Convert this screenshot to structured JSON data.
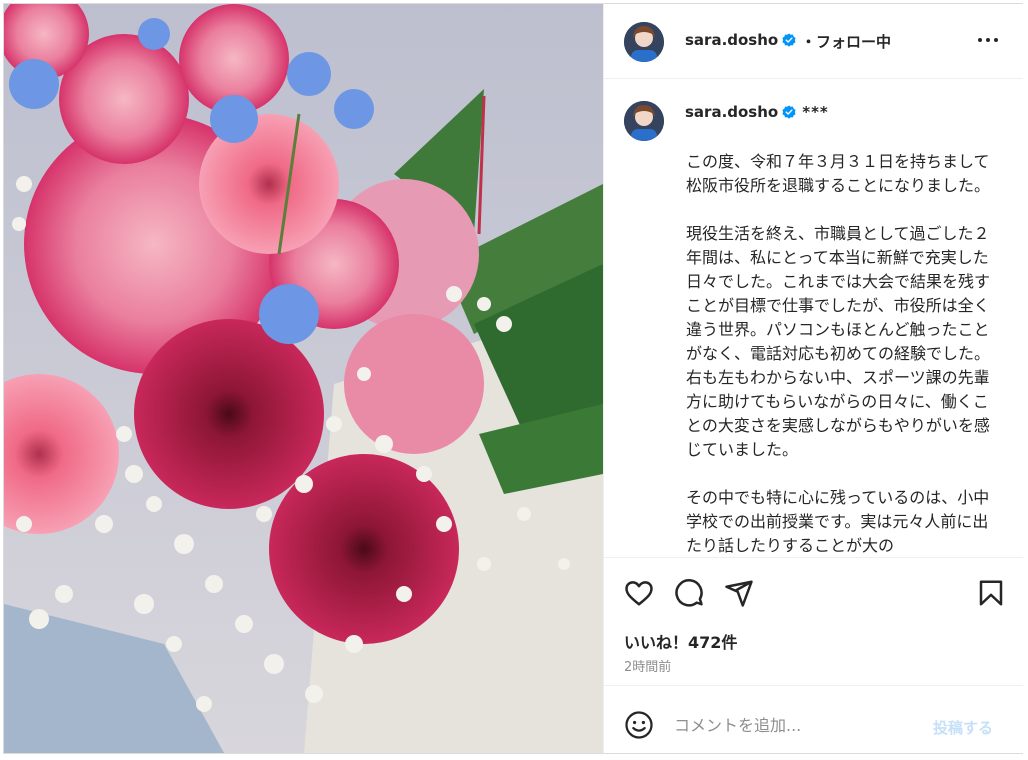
{
  "header": {
    "username": "sara.dosho",
    "separator": "・",
    "follow_label": "フォロー中",
    "more_icon": "more-horizontal-icon"
  },
  "caption": {
    "username": "sara.dosho",
    "stars": "***",
    "text": "この度、令和７年３月３１日を持ちまして松阪市役所を退職することになりました。\n\n現役生活を終え、市職員として過ごした２年間は、私にとって本当に新鮮で充実した日々でした。これまでは大会で結果を残すことが目標で仕事でしたが、市役所は全く違う世界。パソコンもほとんど触ったことがなく、電話対応も初めての経験でした。右も左もわからない中、スポーツ課の先輩方に助けてもらいながらの日々に、働くことの大変さを実感しながらもやりがいを感じていました。\n\nその中でも特に心に残っているのは、小中学校での出前授業です。実は元々人前に出たり話したりすることが大の"
  },
  "actions": {
    "icons": [
      "heart-icon",
      "comment-icon",
      "share-icon",
      "bookmark-icon"
    ],
    "likes": "いいね！472件",
    "time": "2時間前"
  },
  "comment": {
    "placeholder": "コメントを追加...",
    "post_label": "投稿する"
  },
  "colors": {
    "verified": "#0095f6",
    "post_disabled": "#c7e0f9",
    "secondary_text": "#8e8e8e"
  }
}
